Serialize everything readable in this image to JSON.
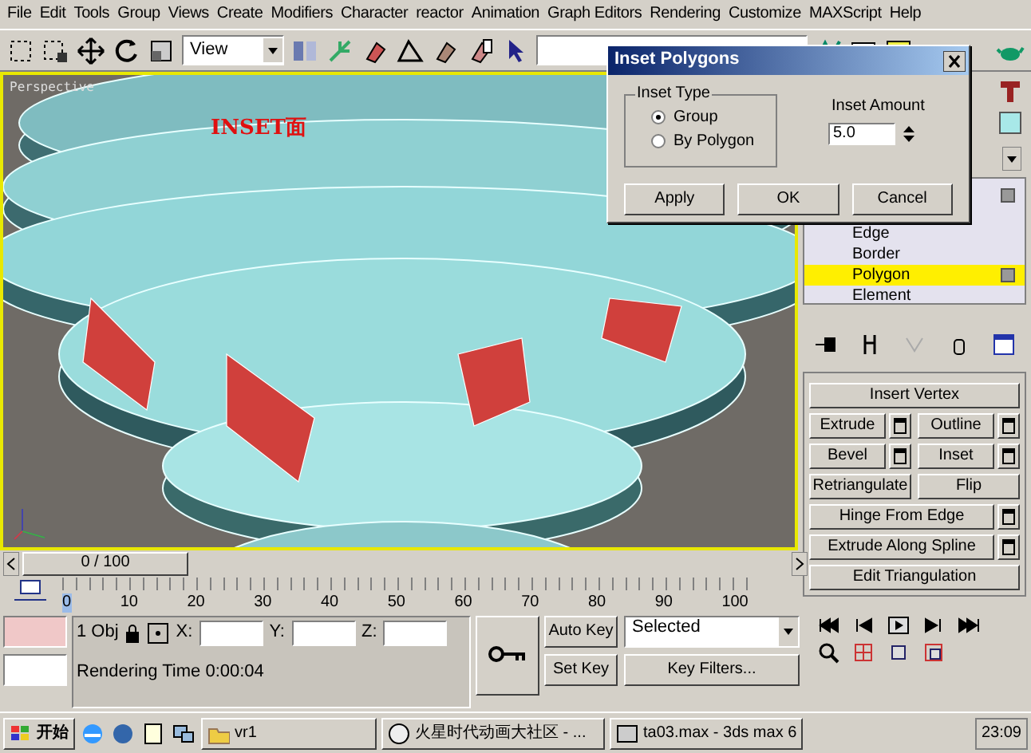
{
  "menu": [
    "File",
    "Edit",
    "Tools",
    "Group",
    "Views",
    "Create",
    "Modifiers",
    "Character",
    "reactor",
    "Animation",
    "Graph Editors",
    "Rendering",
    "Customize",
    "MAXScript",
    "Help"
  ],
  "toolbar": {
    "view_dropdown": "View"
  },
  "viewport": {
    "label": "Perspective",
    "annotation": "INSET面"
  },
  "dialog": {
    "title": "Inset Polygons",
    "group_title": "Inset Type",
    "options": [
      {
        "label": "Group",
        "selected": true
      },
      {
        "label": "By Polygon",
        "selected": false
      }
    ],
    "amount_label": "Inset Amount",
    "amount_value": "5.0",
    "buttons": [
      "Apply",
      "OK",
      "Cancel"
    ]
  },
  "command_panel": {
    "stack": [
      {
        "label": "Edge",
        "selected": false
      },
      {
        "label": "Border",
        "selected": false
      },
      {
        "label": "Polygon",
        "selected": true
      },
      {
        "label": "Element",
        "selected": false
      }
    ],
    "buttons": [
      [
        {
          "label": "Insert Vertex",
          "settings": false
        }
      ],
      [
        {
          "label": "Extrude",
          "settings": true
        },
        {
          "label": "Outline",
          "settings": true
        }
      ],
      [
        {
          "label": "Bevel",
          "settings": true
        },
        {
          "label": "Inset",
          "settings": true
        }
      ],
      [
        {
          "label": "Retriangulate",
          "settings": false
        },
        {
          "label": "Flip",
          "settings": false
        }
      ],
      [
        {
          "label": "Hinge From Edge",
          "settings": true
        }
      ],
      [
        {
          "label": "Extrude Along Spline",
          "settings": true
        }
      ],
      [
        {
          "label": "Edit Triangulation",
          "settings": false
        }
      ]
    ]
  },
  "timeline": {
    "slider": "0 / 100",
    "level": 0,
    "ticks": [
      "0",
      "10",
      "20",
      "30",
      "40",
      "50",
      "60",
      "70",
      "80",
      "90",
      "100"
    ]
  },
  "status": {
    "selection": "1 Obj",
    "x_label": "X:",
    "y_label": "Y:",
    "z_label": "Z:",
    "prompt": "Rendering Time  0:00:04",
    "auto_key": "Auto Key",
    "set_key": "Set Key",
    "key_mode": "Selected",
    "key_filters": "Key Filters..."
  },
  "taskbar": {
    "start": "开始",
    "tasks": [
      "vr1",
      "火星时代动画大社区 - ...",
      "ta03.max - 3ds max 6"
    ],
    "clock": "23:09"
  }
}
